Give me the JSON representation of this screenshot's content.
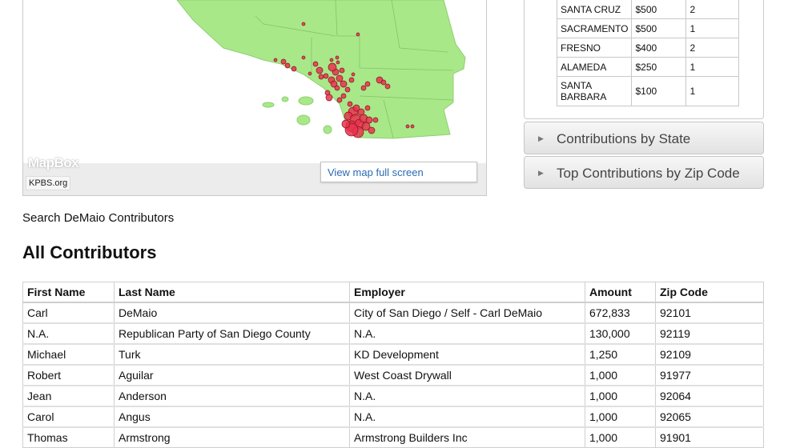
{
  "map": {
    "attribution_logo": "MapBox",
    "source_label": "KPBS.org",
    "fullscreen_label": "View map full screen"
  },
  "city_table": [
    {
      "city": "SANTA CRUZ",
      "amount": "$500",
      "count": "2"
    },
    {
      "city": "SACRAMENTO",
      "amount": "$500",
      "count": "1"
    },
    {
      "city": "FRESNO",
      "amount": "$400",
      "count": "2"
    },
    {
      "city": "ALAMEDA",
      "amount": "$250",
      "count": "1"
    },
    {
      "city": "SANTA BARBARA",
      "amount": "$100",
      "count": "1"
    }
  ],
  "accordions": {
    "state": "Contributions by State",
    "zip": "Top Contributions by Zip Code"
  },
  "search_label": "Search DeMaio Contributors",
  "heading": "All Contributors",
  "contributors": {
    "headers": [
      "First Name",
      "Last Name",
      "Employer",
      "Amount",
      "Zip Code"
    ],
    "rows": [
      [
        "Carl",
        "DeMaio",
        "City of San Diego / Self - Carl DeMaio",
        "672,833",
        "92101"
      ],
      [
        "N.A.",
        "Republican Party of San Diego County",
        "N.A.",
        "130,000",
        "92119"
      ],
      [
        "Michael",
        "Turk",
        "KD Development",
        "1,250",
        "92109"
      ],
      [
        "Robert",
        "Aguilar",
        "West Coast Drywall",
        "1,000",
        "91977"
      ],
      [
        "Jean",
        "Anderson",
        "N.A.",
        "1,000",
        "92064"
      ],
      [
        "Carol",
        "Angus",
        "N.A.",
        "1,000",
        "92065"
      ],
      [
        "Thomas",
        "Armstrong",
        "Armstrong Builders Inc",
        "1,000",
        "91901"
      ]
    ]
  },
  "colors": {
    "land": "#a8e889",
    "marker": "#e8334f",
    "link": "#2a6bb0"
  }
}
